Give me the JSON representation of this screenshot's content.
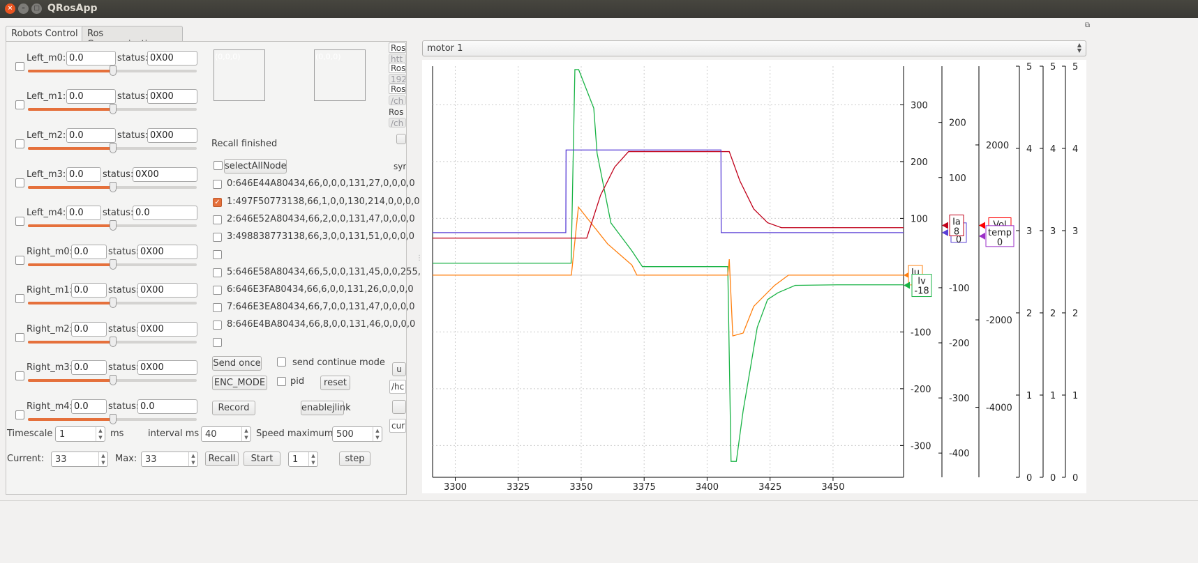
{
  "window": {
    "title": "QRosApp"
  },
  "tabs": [
    {
      "label": "Robots Control",
      "active": true
    },
    {
      "label": "Ros Communications",
      "active": false
    }
  ],
  "motors": [
    {
      "label": "Left_m0:",
      "value": "0.0",
      "status_label": "status:",
      "status": "0X00",
      "slider": 0.5
    },
    {
      "label": "Left_m1:",
      "value": "0.0",
      "status_label": "status:",
      "status": "0X00",
      "slider": 0.5
    },
    {
      "label": "Left_m2:",
      "value": "0.0",
      "status_label": "status:",
      "status": "0X00",
      "slider": 0.5
    },
    {
      "label": "Left_m3:",
      "value": "0.0",
      "status_label": "status:",
      "status": "0X00",
      "slider": 0.5
    },
    {
      "label": "Left_m4:",
      "value": "0.0",
      "status_label": "status:",
      "status": "0.0",
      "slider": 0.5
    },
    {
      "label": "Right_m0:",
      "value": "0.0",
      "status_label": "status:",
      "status": "0X00",
      "slider": 0.5
    },
    {
      "label": "Right_m1:",
      "value": "0.0",
      "status_label": "status:",
      "status": "0X00",
      "slider": 0.5
    },
    {
      "label": "Right_m2:",
      "value": "0.0",
      "status_label": "status:",
      "status": "0X00",
      "slider": 0.5
    },
    {
      "label": "Right_m3:",
      "value": "0.0",
      "status_label": "status:",
      "status": "0X00",
      "slider": 0.5
    },
    {
      "label": "Right_m4:",
      "value": "0.0",
      "status_label": "status:",
      "status": "0.0",
      "slider": 0.5
    }
  ],
  "color_boxes": [
    "(0,0,0)",
    "(0,0,0)"
  ],
  "recall_status": "Recall finished",
  "select_all": "selectAllNode",
  "nodes": [
    {
      "text": "0:646E44A80434,66,0,0,0,131,27,0,0,0,0",
      "checked": false
    },
    {
      "text": "1:497F50773138,66,1,0,0,130,214,0,0,0,0",
      "checked": true
    },
    {
      "text": "2:646E52A80434,66,2,0,0,131,47,0,0,0,0",
      "checked": false
    },
    {
      "text": "3:498838773138,66,3,0,0,131,51,0,0,0,0",
      "checked": false
    },
    {
      "text": "",
      "checked": false
    },
    {
      "text": "5:646E58A80434,66,5,0,0,131,45,0,0,255,",
      "checked": false
    },
    {
      "text": "6:646E3FA80434,66,6,0,0,131,26,0,0,0,0",
      "checked": false
    },
    {
      "text": "7:646E3EA80434,66,7,0,0,131,47,0,0,0,0",
      "checked": false
    },
    {
      "text": "8:646E4BA80434,66,8,0,0,131,46,0,0,0,0",
      "checked": false
    },
    {
      "text": "",
      "checked": false
    }
  ],
  "controls": {
    "send_once": "Send once",
    "send_continue": "send  continue mode",
    "enc_mode": "ENC_MODE",
    "pid": "pid",
    "reset": "reset",
    "record": "Record",
    "enablejlink": "enablejlink"
  },
  "clipped": {
    "ros1": "Ros",
    "url1": "htt",
    "ros2": "Ros",
    "ip": "192",
    "ros3": "Ros",
    "path1": "/ch",
    "ros4": "Ros",
    "path2": "/ch",
    "syr": "syr",
    "u": "u",
    "hc": "/hc",
    "cur": "cur"
  },
  "bottom": {
    "timescale_label": "Timescale",
    "timescale": "1",
    "ms": "ms",
    "interval_label": "interval ms",
    "interval": "40",
    "speed_label": "Speed maximum",
    "speed": "500",
    "current_label": "Current:",
    "current": "33",
    "max_label": "Max:",
    "max": "33",
    "recall": "Recall",
    "start": "Start",
    "step_value": "1",
    "step": "step"
  },
  "motor_select": "motor 1",
  "chart_data": {
    "type": "line",
    "grid": true,
    "xlim": [
      3291,
      3478
    ],
    "x_ticks": [
      3300,
      3325,
      3350,
      3375,
      3400,
      3425,
      3450
    ],
    "axes": [
      {
        "id": "a1",
        "range": [
          -356,
          368
        ],
        "ticks": [
          -300,
          -200,
          -100,
          100,
          200,
          300
        ]
      },
      {
        "id": "a2",
        "range": [
          -444,
          302
        ],
        "ticks": [
          -400,
          -300,
          -200,
          -100,
          100,
          200
        ]
      },
      {
        "id": "a3",
        "range": [
          -5600,
          3800
        ],
        "ticks": [
          -4000,
          -2000,
          2000
        ]
      },
      {
        "id": "a4",
        "range": [
          0,
          5
        ],
        "ticks": [
          0,
          1,
          2,
          3,
          4,
          5
        ]
      },
      {
        "id": "a5",
        "range": [
          0,
          5
        ],
        "ticks": [
          0,
          1,
          2,
          3,
          4,
          5
        ]
      },
      {
        "id": "a6",
        "range": [
          0,
          5
        ],
        "ticks": [
          0,
          1,
          2,
          3,
          4,
          5
        ]
      }
    ],
    "series": [
      {
        "name": "Iv",
        "value": "-18",
        "axis": "a1",
        "color": "#19b345",
        "x": [
          3291,
          3346,
          3347.5,
          3349,
          3355,
          3356.3,
          3361.8,
          3370.1,
          3374.3,
          3408.2,
          3409.5,
          3411.6,
          3414.3,
          3417.1,
          3419.9,
          3424,
          3428.1,
          3435,
          3451.6,
          3478
        ],
        "y": [
          21,
          21,
          362,
          362,
          294,
          215,
          92,
          43,
          15,
          15,
          -328,
          -328,
          -239,
          -166,
          -92,
          -43,
          -31,
          -18,
          -17,
          -17
        ]
      },
      {
        "name": "Iu",
        "value": "0",
        "axis": "a1",
        "color": "#ff7f0e",
        "x": [
          3291,
          3346.1,
          3348.9,
          3360.5,
          3370.1,
          3372.1,
          3408.2,
          3408.8,
          3410.2,
          3414.3,
          3418.5,
          3426.8,
          3432.3,
          3478
        ],
        "y": [
          0,
          0,
          120,
          55,
          18,
          0,
          0,
          28,
          -107,
          -102,
          -55,
          -18,
          0,
          0
        ]
      },
      {
        "name": "Ia",
        "value": "8",
        "axis": "a2",
        "color": "#c0001a",
        "x": [
          3291,
          3352.2,
          3357.7,
          3363.3,
          3368.8,
          3408.8,
          3413,
          3418.5,
          3424,
          3429.5,
          3478
        ],
        "y": [
          -10,
          -10,
          68,
          119,
          147,
          147,
          94,
          43,
          18,
          9,
          9
        ]
      },
      {
        "name": "",
        "value": "0",
        "axis": "a2",
        "color": "#5a3fd6",
        "x": [
          3291,
          3343.9,
          3344,
          3405.5,
          3405.6,
          3478
        ],
        "y": [
          0,
          0,
          150,
          150,
          0,
          0
        ]
      },
      {
        "name": "Vol",
        "value": "",
        "axis": "a3",
        "color": "#ff0000",
        "x": [],
        "y": []
      },
      {
        "name": "temp",
        "value": "0",
        "axis": "a3",
        "color": "#9b30c8",
        "x": [],
        "y": []
      }
    ]
  }
}
